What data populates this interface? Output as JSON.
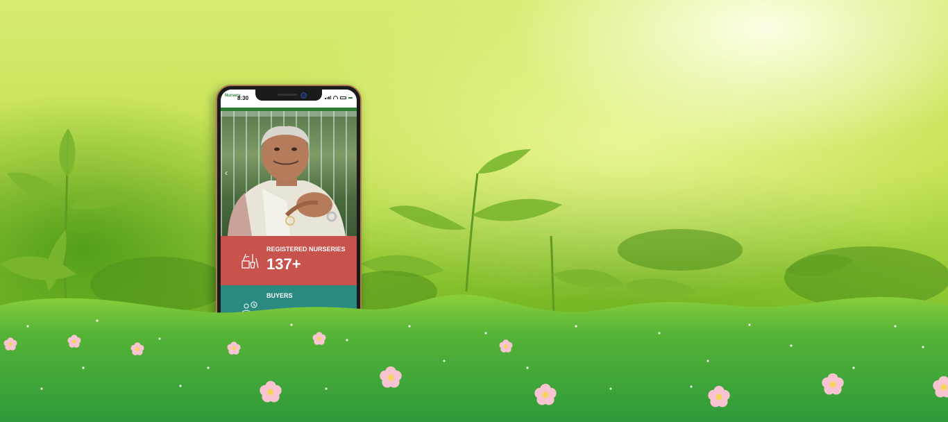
{
  "phone": {
    "brand": "Nursery",
    "brand_sub": "",
    "time": "8:30",
    "login_label": "",
    "nav_items": [
      "",
      "",
      "",
      "",
      "",
      ""
    ]
  },
  "stats": [
    {
      "label": "REGISTERED NURSERIES",
      "value": "137+",
      "icon": "gardening-tools-icon",
      "color": "#c8524c"
    },
    {
      "label": "BUYERS",
      "value": "",
      "icon": "people-icon",
      "color": "#2a8a82"
    }
  ],
  "carousel": {
    "prev_icon": "chevron-left-icon",
    "prev_symbol": "‹"
  },
  "colors": {
    "grass": "#3fa535",
    "accent": "#2e7d32",
    "flower": "#f7b8c8"
  }
}
